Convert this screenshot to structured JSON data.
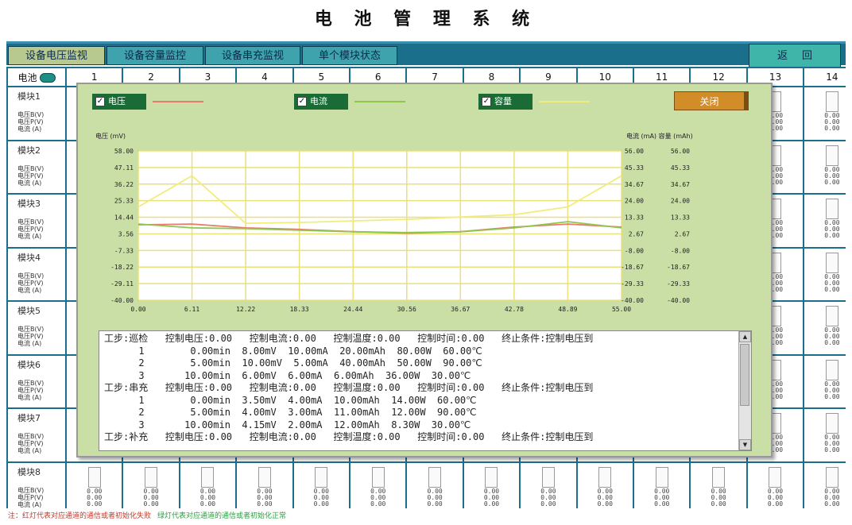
{
  "window": {
    "title": "电 池 管 理 系 统"
  },
  "tabs": [
    {
      "label": "设备电压监视",
      "active": true
    },
    {
      "label": "设备容量监控",
      "active": false
    },
    {
      "label": "设备串充监视",
      "active": false
    },
    {
      "label": "单个模块状态",
      "active": false
    }
  ],
  "back_label": "返回",
  "grid": {
    "battery_label": "电池",
    "columns": [
      "1",
      "2",
      "3",
      "4",
      "5",
      "6",
      "7",
      "8",
      "9",
      "10",
      "11",
      "12",
      "13",
      "14"
    ],
    "modules": [
      "模块1",
      "模块2",
      "模块3",
      "模块4",
      "模块5",
      "模块6",
      "模块7",
      "模块8"
    ],
    "row_labels": [
      "电压B(V)",
      "电压P(V)",
      "电流 (A)"
    ],
    "cell_value": "0.00"
  },
  "popup": {
    "legend": [
      {
        "label": "电压",
        "checked": true,
        "color": "#e87a6e"
      },
      {
        "label": "电流",
        "checked": true,
        "color": "#8ec74a"
      },
      {
        "label": "容量",
        "checked": true,
        "color": "#f2ec7e"
      }
    ],
    "close_label": "关闭",
    "log_lines": [
      "工步:巡检   控制电压:0.00   控制电流:0.00   控制温度:0.00   控制时间:0.00   终止条件:控制电压到",
      "      1        0.00min  8.00mV  10.00mA  20.00mAh  80.00W  60.00℃",
      "      2        5.00min  10.00mV  5.00mA  40.00mAh  50.00W  90.00℃",
      "      3       10.00min  6.00mV  6.00mA  6.00mAh  36.00W  30.00℃",
      "工步:串充   控制电压:0.00   控制电流:0.00   控制温度:0.00   控制时间:0.00   终止条件:控制电压到",
      "      1        0.00min  3.50mV  4.00mA  10.00mAh  14.00W  60.00℃",
      "      2        5.00min  4.00mV  3.00mA  11.00mAh  12.00W  90.00℃",
      "      3       10.00min  4.15mV  2.00mA  12.00mAh  8.30W  30.00℃",
      "工步:补充   控制电压:0.00   控制电流:0.00   控制温度:0.00   控制时间:0.00   终止条件:控制电压到"
    ]
  },
  "chart_data": {
    "type": "line",
    "ylabel_left": "电压 (mV)",
    "ylabel_right": "电流 (mA) 容量 (mAh)",
    "x_ticks": [
      "0.00",
      "6.11",
      "12.22",
      "18.33",
      "24.44",
      "30.56",
      "36.67",
      "42.78",
      "48.89",
      "55.00"
    ],
    "y_left_ticks": [
      "58.00",
      "47.11",
      "36.22",
      "25.33",
      "14.44",
      "3.56",
      "-7.33",
      "-18.22",
      "-29.11",
      "-40.00"
    ],
    "y_right_ticks_a": [
      "56.00",
      "45.33",
      "34.67",
      "24.00",
      "13.33",
      "2.67",
      "-8.00",
      "-18.67",
      "-29.33",
      "-40.00"
    ],
    "y_right_ticks_b": [
      "56.00",
      "45.33",
      "34.67",
      "24.00",
      "13.33",
      "2.67",
      "-8.00",
      "-18.67",
      "-29.33",
      "-40.00"
    ],
    "xlim": [
      0,
      55
    ],
    "ylim_left": [
      -40,
      58
    ],
    "ylim_right": [
      -40,
      56
    ],
    "series": [
      {
        "name": "电压",
        "axis": "left",
        "color": "#e87a6e",
        "x": [
          0,
          6.11,
          12.22,
          18.33,
          24.44,
          30.56,
          36.67,
          42.78,
          48.89,
          55.0
        ],
        "y": [
          9.5,
          10.0,
          7.5,
          6.5,
          5.0,
          4.0,
          5.0,
          8.0,
          10.0,
          8.0
        ]
      },
      {
        "name": "电流",
        "axis": "right",
        "color": "#8ec74a",
        "x": [
          0,
          6.11,
          12.22,
          18.33,
          24.44,
          30.56,
          36.67,
          42.78,
          48.89,
          55.0
        ],
        "y": [
          9.0,
          6.5,
          6.0,
          5.0,
          4.0,
          3.5,
          4.0,
          6.5,
          10.5,
          6.5
        ]
      },
      {
        "name": "容量",
        "axis": "right",
        "color": "#f2ec7e",
        "x": [
          0,
          6.11,
          12.22,
          18.33,
          24.44,
          30.56,
          36.67,
          42.78,
          48.89,
          55.0
        ],
        "y": [
          20.0,
          40.0,
          9.5,
          10.0,
          11.0,
          12.0,
          13.5,
          15.0,
          20.0,
          40.0
        ]
      }
    ],
    "grid": true
  },
  "footer": {
    "note_red": "注：红灯代表对应通道的通信或者初始化失败",
    "note_green": "绿灯代表对应通道的通信或者初始化正常"
  }
}
